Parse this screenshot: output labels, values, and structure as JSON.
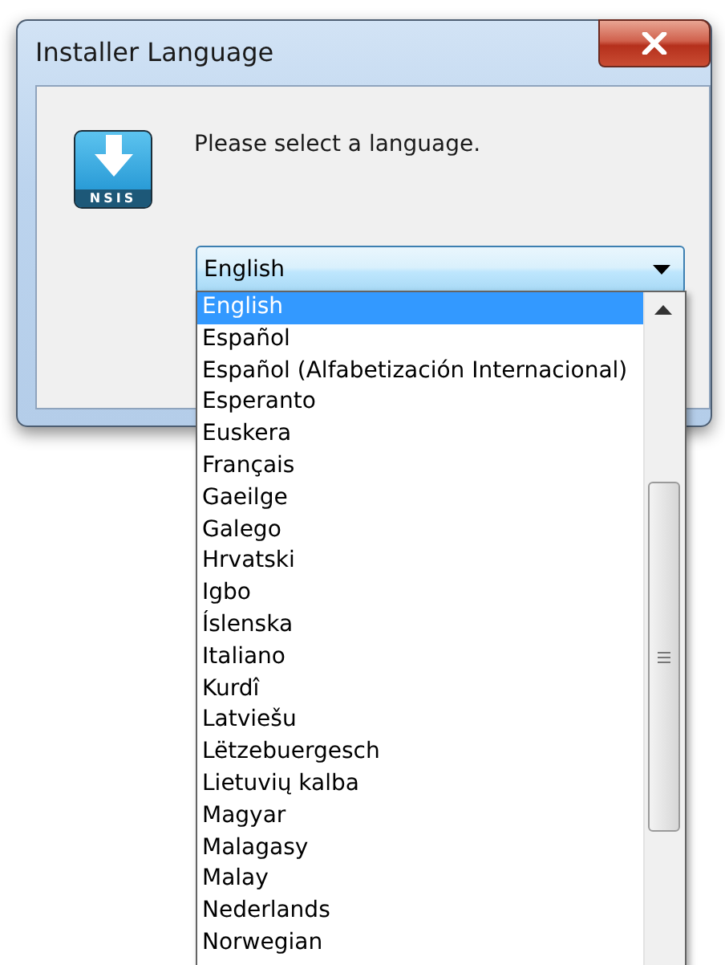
{
  "window": {
    "title": "Installer Language"
  },
  "logo": {
    "text": "NSIS"
  },
  "message": "Please select a language.",
  "combo": {
    "value": "English",
    "expanded": true
  },
  "options": [
    {
      "label": "English",
      "selected": true
    },
    {
      "label": "Español",
      "selected": false
    },
    {
      "label": "Español (Alfabetización Internacional)",
      "selected": false
    },
    {
      "label": "Esperanto",
      "selected": false
    },
    {
      "label": "Euskera",
      "selected": false
    },
    {
      "label": "Français",
      "selected": false
    },
    {
      "label": "Gaeilge",
      "selected": false
    },
    {
      "label": "Galego",
      "selected": false
    },
    {
      "label": "Hrvatski",
      "selected": false
    },
    {
      "label": "Igbo",
      "selected": false
    },
    {
      "label": "Íslenska",
      "selected": false
    },
    {
      "label": "Italiano",
      "selected": false
    },
    {
      "label": "Kurdî",
      "selected": false
    },
    {
      "label": "Latviešu",
      "selected": false
    },
    {
      "label": "Lëtzebuergesch",
      "selected": false
    },
    {
      "label": "Lietuvių kalba",
      "selected": false
    },
    {
      "label": "Magyar",
      "selected": false
    },
    {
      "label": "Malagasy",
      "selected": false
    },
    {
      "label": "Malay",
      "selected": false
    },
    {
      "label": "Nederlands",
      "selected": false
    },
    {
      "label": "Norwegian",
      "selected": false
    }
  ]
}
